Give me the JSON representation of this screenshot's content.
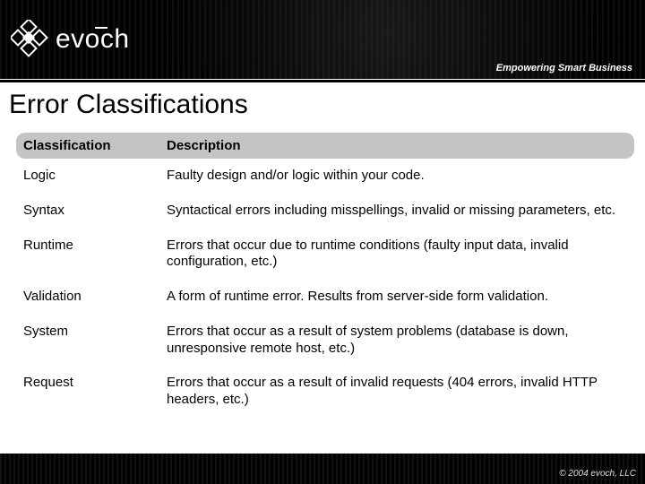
{
  "brand": {
    "name": "evoch",
    "tagline": "Empowering Smart Business"
  },
  "page": {
    "title": "Error Classifications"
  },
  "table": {
    "headers": {
      "col1": "Classification",
      "col2": "Description"
    },
    "rows": [
      {
        "classification": "Logic",
        "description": "Faulty design and/or logic within your code."
      },
      {
        "classification": "Syntax",
        "description": "Syntactical errors including misspellings, invalid or missing parameters, etc."
      },
      {
        "classification": "Runtime",
        "description": "Errors that occur due to runtime conditions (faulty input data, invalid configuration, etc.)"
      },
      {
        "classification": "Validation",
        "description": "A form of runtime error.  Results from server-side form validation."
      },
      {
        "classification": "System",
        "description": "Errors that occur as a result of system problems (database is down, unresponsive remote host, etc.)"
      },
      {
        "classification": "Request",
        "description": "Errors that occur as a result of invalid requests (404 errors, invalid HTTP headers, etc.)"
      }
    ]
  },
  "footer": {
    "copyright": "© 2004 evoch, LLC"
  }
}
